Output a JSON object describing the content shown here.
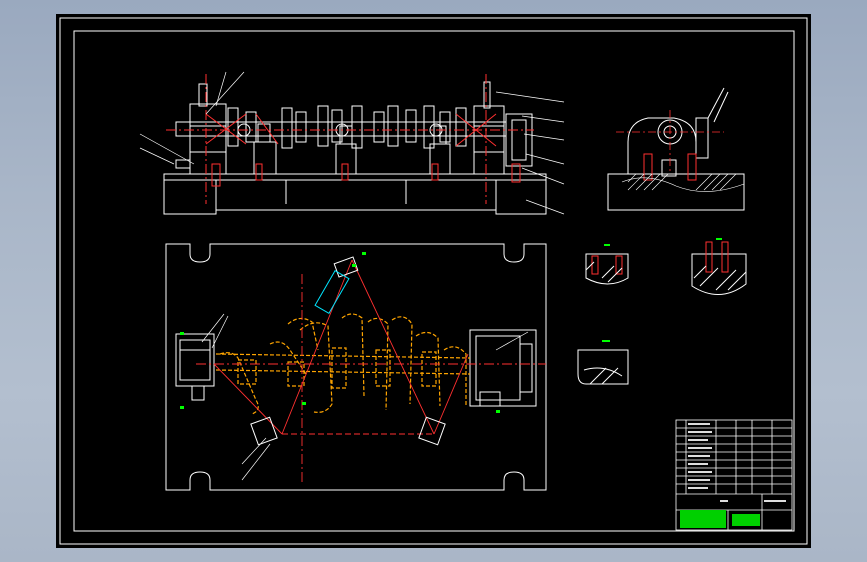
{
  "view": {
    "background": "#000000",
    "frame_color": "#ffffff",
    "part_color": "#ffffff",
    "workpiece_color": "#ffa500",
    "center_line_color": "#ff2020",
    "section_line_color": "#ff3030",
    "highlight_color": "#00e5ff",
    "annotation_color": "#00ff00",
    "titleblock_fill": "#00d000"
  }
}
